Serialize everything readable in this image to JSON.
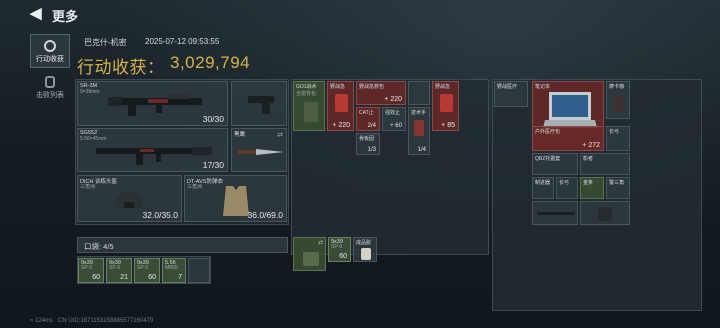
{
  "header": {
    "back_icon": "back-arrow-icon",
    "title": "更多"
  },
  "sidebar": {
    "items": [
      {
        "label": "行动收获",
        "icon": "target-icon",
        "active": true
      },
      {
        "label": "击败列表",
        "icon": "soldier-icon",
        "active": false
      }
    ]
  },
  "operation": {
    "map": "巴克什-机密",
    "timestamp": "2025-07-12 09:53:55",
    "gain_label": "行动收获：",
    "gain_value": "3,029,794"
  },
  "loadout": {
    "primary": {
      "name": "SR-3M",
      "sub": "9×39mm",
      "ammo": "30/30"
    },
    "secondary": {
      "name": "SG552",
      "sub": "5.56×45mm",
      "ammo": "17/30"
    },
    "melee": {
      "name": "黑鹰"
    },
    "helmet": {
      "name": "DICH 训练头盔",
      "sub": "三角洲",
      "durability": "32.0/35.0"
    },
    "armor": {
      "name": "DT-AVS防弹衣",
      "sub": "三角洲",
      "durability": "36.0/69.0"
    }
  },
  "pockets": {
    "label": "口袋: 4/5",
    "items": [
      {
        "name": "9x39",
        "sub": "SP-5",
        "count": "60"
      },
      {
        "name": "9x39",
        "sub": "SP-6",
        "count": "21"
      },
      {
        "name": "9x39",
        "sub": "SP-5",
        "count": "60"
      },
      {
        "name": "5.56",
        "sub": "M855",
        "count": "7"
      }
    ]
  },
  "rig": {
    "items": [
      {
        "name": "GO1战术",
        "sub": "全能背包"
      },
      {
        "name": "野战急",
        "count": "+ 220"
      },
      {
        "name": "野战急救包",
        "count": "+ 220"
      },
      {
        "name": "野战急",
        "count": "+ 85"
      },
      {
        "name": "CAT止",
        "count": "2/4"
      },
      {
        "name": "强效止",
        "count": "+ 60"
      },
      {
        "name": "技术手",
        "count": "1/4"
      },
      {
        "name": "骨板固",
        "count": "1/3"
      }
    ]
  },
  "backpack": {
    "items": [
      {
        "name": "9x39",
        "sub": "SP-6",
        "count": "60"
      },
      {
        "name": "成品胶"
      }
    ]
  },
  "safebox": {
    "items": [
      {
        "name": "野战医疗"
      },
      {
        "name": "笔记本"
      },
      {
        "name": "摩卡咖"
      },
      {
        "name": "户外医疗包",
        "count": "+ 272"
      },
      {
        "name": "长弓"
      },
      {
        "name": "QBZ托握套"
      },
      {
        "name": "影者"
      },
      {
        "name": "制进器"
      },
      {
        "name": "长弓"
      },
      {
        "name": "金条"
      },
      {
        "name": "警三角"
      }
    ]
  },
  "footer": {
    "ping": "124ms",
    "uid": "CN UID:1871153158885577160479"
  }
}
